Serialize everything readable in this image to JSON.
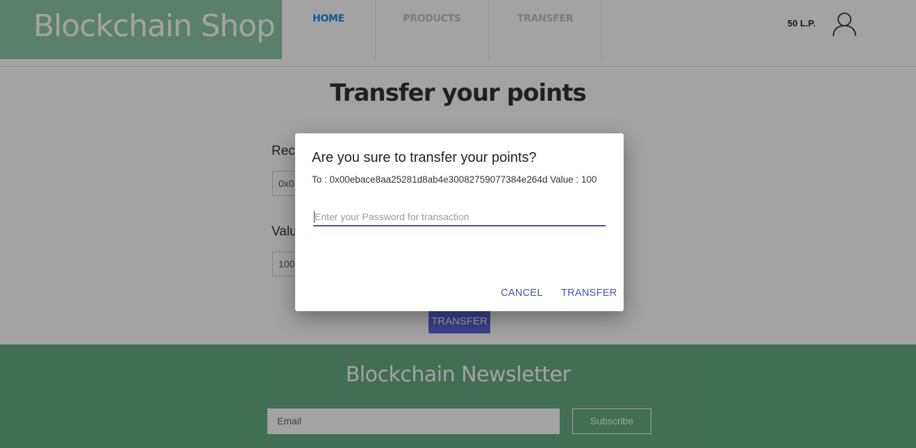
{
  "header": {
    "brand": "Blockchain Shop",
    "nav": [
      {
        "label": "HOME",
        "active": true
      },
      {
        "label": "PRODUCTS",
        "active": false
      },
      {
        "label": "TRANSFER",
        "active": false
      }
    ],
    "points": "50 L.P.",
    "user_icon": "user-icon"
  },
  "main": {
    "title": "Transfer your points",
    "recipient_label": "Rec",
    "recipient_value": "0x0",
    "value_label": "Valu",
    "value_value": "100",
    "transfer_button": "TRANSFER"
  },
  "footer": {
    "title": "Blockchain Newsletter",
    "email_placeholder": "Email",
    "subscribe_label": "Subscribe"
  },
  "dialog": {
    "title": "Are you sure to transfer your points?",
    "details": "To : 0x00ebace8aa25281d8ab4e30082759077384e264d Value : 100",
    "password_placeholder": "Enter your Password for transaction",
    "cancel_label": "CANCEL",
    "transfer_label": "TRANSFER"
  },
  "colors": {
    "brand_green": "#8cc9a6",
    "footer_green": "#66ad84",
    "accent": "#3f51b5",
    "nav_active": "#1a8fd6"
  }
}
